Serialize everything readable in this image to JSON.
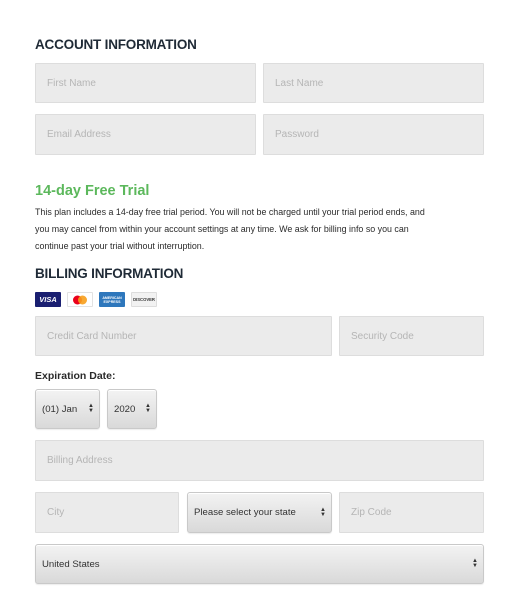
{
  "account": {
    "title": "ACCOUNT INFORMATION",
    "first_name_placeholder": "First Name",
    "last_name_placeholder": "Last Name",
    "email_placeholder": "Email Address",
    "password_placeholder": "Password"
  },
  "trial": {
    "title": "14-day Free Trial",
    "line1": "This plan includes a 14-day free trial period. You will not be charged until your trial period ends, and",
    "line2": "you may cancel from within your account settings at any time. We ask for billing info so you can",
    "line3": "continue past your trial without interruption."
  },
  "billing": {
    "title": "BILLING INFORMATION",
    "cards": [
      {
        "name": "visa-icon",
        "label": "VISA",
        "color": "#1a1f71"
      },
      {
        "name": "mastercard-icon",
        "label": "",
        "color": "#ffffff"
      },
      {
        "name": "amex-icon",
        "label": "AMERICAN EXPRESS",
        "color": "#2e77bc"
      },
      {
        "name": "discover-icon",
        "label": "DISCOVER",
        "color": "#f2f2f2"
      }
    ],
    "card_number_placeholder": "Credit Card Number",
    "security_code_placeholder": "Security Code",
    "expiration_label": "Expiration Date:",
    "month_value": "(01) Jan",
    "year_value": "2020",
    "address_placeholder": "Billing Address",
    "city_placeholder": "City",
    "state_value": "Please select your state",
    "zip_placeholder": "Zip Code",
    "country_value": "United States"
  }
}
